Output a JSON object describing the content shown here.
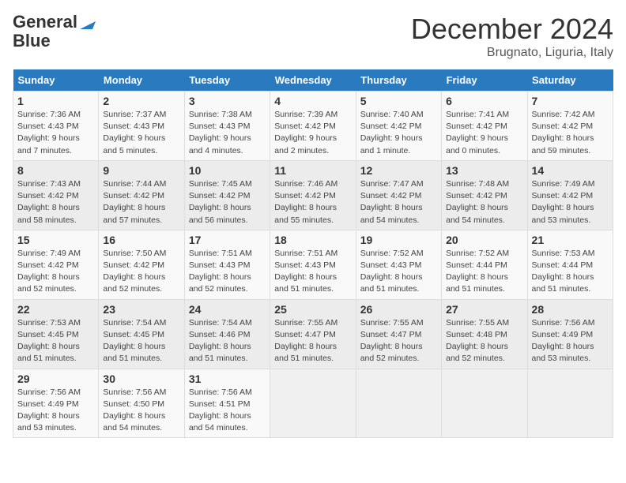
{
  "header": {
    "logo_line1": "General",
    "logo_line2": "Blue",
    "month": "December 2024",
    "location": "Brugnato, Liguria, Italy"
  },
  "weekdays": [
    "Sunday",
    "Monday",
    "Tuesday",
    "Wednesday",
    "Thursday",
    "Friday",
    "Saturday"
  ],
  "weeks": [
    [
      {
        "day": "1",
        "info": "Sunrise: 7:36 AM\nSunset: 4:43 PM\nDaylight: 9 hours\nand 7 minutes."
      },
      {
        "day": "2",
        "info": "Sunrise: 7:37 AM\nSunset: 4:43 PM\nDaylight: 9 hours\nand 5 minutes."
      },
      {
        "day": "3",
        "info": "Sunrise: 7:38 AM\nSunset: 4:43 PM\nDaylight: 9 hours\nand 4 minutes."
      },
      {
        "day": "4",
        "info": "Sunrise: 7:39 AM\nSunset: 4:42 PM\nDaylight: 9 hours\nand 2 minutes."
      },
      {
        "day": "5",
        "info": "Sunrise: 7:40 AM\nSunset: 4:42 PM\nDaylight: 9 hours\nand 1 minute."
      },
      {
        "day": "6",
        "info": "Sunrise: 7:41 AM\nSunset: 4:42 PM\nDaylight: 9 hours\nand 0 minutes."
      },
      {
        "day": "7",
        "info": "Sunrise: 7:42 AM\nSunset: 4:42 PM\nDaylight: 8 hours\nand 59 minutes."
      }
    ],
    [
      {
        "day": "8",
        "info": "Sunrise: 7:43 AM\nSunset: 4:42 PM\nDaylight: 8 hours\nand 58 minutes."
      },
      {
        "day": "9",
        "info": "Sunrise: 7:44 AM\nSunset: 4:42 PM\nDaylight: 8 hours\nand 57 minutes."
      },
      {
        "day": "10",
        "info": "Sunrise: 7:45 AM\nSunset: 4:42 PM\nDaylight: 8 hours\nand 56 minutes."
      },
      {
        "day": "11",
        "info": "Sunrise: 7:46 AM\nSunset: 4:42 PM\nDaylight: 8 hours\nand 55 minutes."
      },
      {
        "day": "12",
        "info": "Sunrise: 7:47 AM\nSunset: 4:42 PM\nDaylight: 8 hours\nand 54 minutes."
      },
      {
        "day": "13",
        "info": "Sunrise: 7:48 AM\nSunset: 4:42 PM\nDaylight: 8 hours\nand 54 minutes."
      },
      {
        "day": "14",
        "info": "Sunrise: 7:49 AM\nSunset: 4:42 PM\nDaylight: 8 hours\nand 53 minutes."
      }
    ],
    [
      {
        "day": "15",
        "info": "Sunrise: 7:49 AM\nSunset: 4:42 PM\nDaylight: 8 hours\nand 52 minutes."
      },
      {
        "day": "16",
        "info": "Sunrise: 7:50 AM\nSunset: 4:42 PM\nDaylight: 8 hours\nand 52 minutes."
      },
      {
        "day": "17",
        "info": "Sunrise: 7:51 AM\nSunset: 4:43 PM\nDaylight: 8 hours\nand 52 minutes."
      },
      {
        "day": "18",
        "info": "Sunrise: 7:51 AM\nSunset: 4:43 PM\nDaylight: 8 hours\nand 51 minutes."
      },
      {
        "day": "19",
        "info": "Sunrise: 7:52 AM\nSunset: 4:43 PM\nDaylight: 8 hours\nand 51 minutes."
      },
      {
        "day": "20",
        "info": "Sunrise: 7:52 AM\nSunset: 4:44 PM\nDaylight: 8 hours\nand 51 minutes."
      },
      {
        "day": "21",
        "info": "Sunrise: 7:53 AM\nSunset: 4:44 PM\nDaylight: 8 hours\nand 51 minutes."
      }
    ],
    [
      {
        "day": "22",
        "info": "Sunrise: 7:53 AM\nSunset: 4:45 PM\nDaylight: 8 hours\nand 51 minutes."
      },
      {
        "day": "23",
        "info": "Sunrise: 7:54 AM\nSunset: 4:45 PM\nDaylight: 8 hours\nand 51 minutes."
      },
      {
        "day": "24",
        "info": "Sunrise: 7:54 AM\nSunset: 4:46 PM\nDaylight: 8 hours\nand 51 minutes."
      },
      {
        "day": "25",
        "info": "Sunrise: 7:55 AM\nSunset: 4:47 PM\nDaylight: 8 hours\nand 51 minutes."
      },
      {
        "day": "26",
        "info": "Sunrise: 7:55 AM\nSunset: 4:47 PM\nDaylight: 8 hours\nand 52 minutes."
      },
      {
        "day": "27",
        "info": "Sunrise: 7:55 AM\nSunset: 4:48 PM\nDaylight: 8 hours\nand 52 minutes."
      },
      {
        "day": "28",
        "info": "Sunrise: 7:56 AM\nSunset: 4:49 PM\nDaylight: 8 hours\nand 53 minutes."
      }
    ],
    [
      {
        "day": "29",
        "info": "Sunrise: 7:56 AM\nSunset: 4:49 PM\nDaylight: 8 hours\nand 53 minutes."
      },
      {
        "day": "30",
        "info": "Sunrise: 7:56 AM\nSunset: 4:50 PM\nDaylight: 8 hours\nand 54 minutes."
      },
      {
        "day": "31",
        "info": "Sunrise: 7:56 AM\nSunset: 4:51 PM\nDaylight: 8 hours\nand 54 minutes."
      },
      {
        "day": "",
        "info": ""
      },
      {
        "day": "",
        "info": ""
      },
      {
        "day": "",
        "info": ""
      },
      {
        "day": "",
        "info": ""
      }
    ]
  ]
}
